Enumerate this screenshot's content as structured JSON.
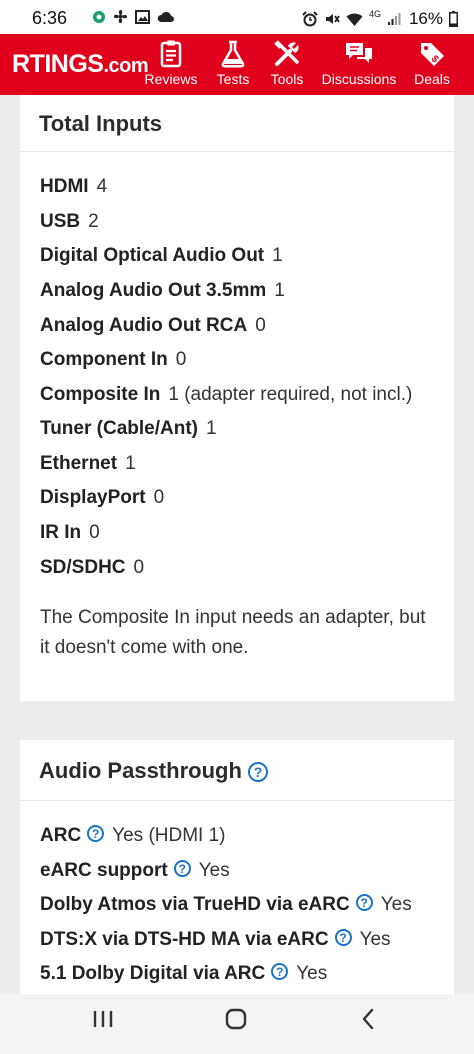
{
  "status_bar": {
    "time": "6:36",
    "battery": "16%",
    "network": "4G",
    "left_icons": [
      "app-icon",
      "fan-icon",
      "image-icon",
      "cloud-icon"
    ],
    "right_icons": [
      "alarm-icon",
      "mute-icon",
      "wifi-icon",
      "signal-icon",
      "battery-icon"
    ]
  },
  "site": {
    "logo": "RTINGS",
    "logo_suffix": ".com",
    "brand_color": "#e1001b"
  },
  "nav": [
    {
      "label": "Reviews",
      "icon": "clipboard-icon"
    },
    {
      "label": "Tests",
      "icon": "flask-icon"
    },
    {
      "label": "Tools",
      "icon": "tools-icon"
    },
    {
      "label": "Discussions",
      "icon": "chat-icon"
    },
    {
      "label": "Deals",
      "icon": "tag-icon"
    }
  ],
  "total_inputs": {
    "title": "Total Inputs",
    "rows": [
      {
        "label": "HDMI",
        "value": "4"
      },
      {
        "label": "USB",
        "value": "2"
      },
      {
        "label": "Digital Optical Audio Out",
        "value": "1"
      },
      {
        "label": "Analog Audio Out 3.5mm",
        "value": "1"
      },
      {
        "label": "Analog Audio Out RCA",
        "value": "0"
      },
      {
        "label": "Component In",
        "value": "0"
      },
      {
        "label": "Composite In",
        "value": "1 (adapter required, not incl.)"
      },
      {
        "label": "Tuner (Cable/Ant)",
        "value": "1"
      },
      {
        "label": "Ethernet",
        "value": "1"
      },
      {
        "label": "DisplayPort",
        "value": "0"
      },
      {
        "label": "IR In",
        "value": "0"
      },
      {
        "label": "SD/SDHC",
        "value": "0"
      }
    ],
    "note": "The Composite In input needs an adapter, but it doesn't come with one."
  },
  "audio_passthrough": {
    "title": "Audio Passthrough",
    "help_glyph": "?",
    "rows": [
      {
        "label": "ARC",
        "value": "Yes (HDMI 1)"
      },
      {
        "label": "eARC support",
        "value": "Yes"
      },
      {
        "label": "Dolby Atmos via TrueHD via eARC",
        "value": "Yes"
      },
      {
        "label": "DTS:X via DTS-HD MA via eARC",
        "value": "Yes"
      },
      {
        "label": "5.1 Dolby Digital via ARC",
        "value": "Yes"
      }
    ]
  },
  "system_nav": {
    "buttons": [
      "recents-icon",
      "home-icon",
      "back-icon"
    ]
  }
}
